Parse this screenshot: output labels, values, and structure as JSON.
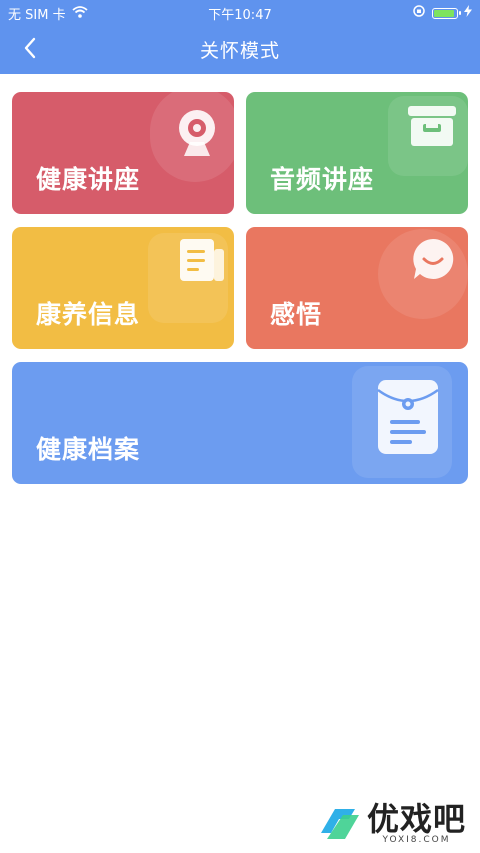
{
  "status_bar": {
    "carrier": "无 SIM 卡",
    "time": "下午10:47",
    "battery_level": 0.9,
    "icons": [
      "wifi-icon",
      "orientation-lock-icon",
      "battery-icon",
      "charging-icon"
    ]
  },
  "nav": {
    "title": "关怀模式",
    "back_icon": "chevron-left-icon"
  },
  "cards": [
    {
      "label": "健康讲座",
      "color": "#d65c6a",
      "icon": "webcam-icon"
    },
    {
      "label": "音频讲座",
      "color": "#6dbf7a",
      "icon": "archive-box-icon"
    },
    {
      "label": "康养信息",
      "color": "#f2bd44",
      "icon": "newspaper-icon"
    },
    {
      "label": "感悟",
      "color": "#e97760",
      "icon": "smile-chat-icon"
    },
    {
      "label": "健康档案",
      "color": "#6c9cf0",
      "icon": "document-envelope-icon"
    }
  ],
  "watermark": {
    "brand": "优戏吧",
    "domain": "YOXI8.COM"
  }
}
